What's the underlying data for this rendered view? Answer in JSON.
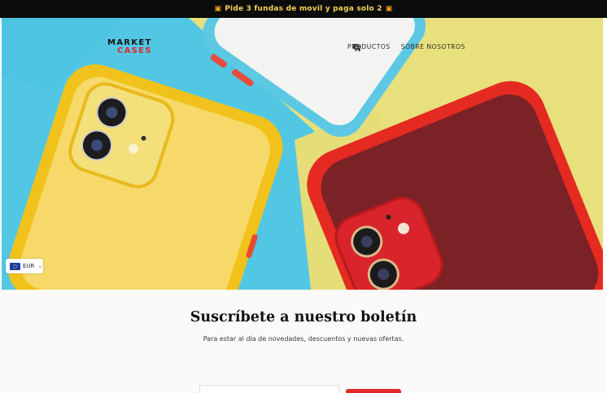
{
  "announcement": {
    "text": "Pide 3 fundas de movil y paga solo 2",
    "icon_left": "gift-icon",
    "icon_right": "gift-icon"
  },
  "header": {
    "logo_line1": "MARKET",
    "logo_line2": "CASES",
    "nav": {
      "products": "PRODUCTOS",
      "about": "SOBRE NOSOTROS"
    },
    "icons": {
      "search": "search-icon",
      "cart": "cart-icon"
    }
  },
  "currency": {
    "selected": "EUR",
    "flag_icon": "eu-flag-icon",
    "chevron": "chevron-down-icon"
  },
  "newsletter": {
    "title": "Suscríbete a nuestro boletín",
    "subtitle": "Para estar al día de novedades, descuentos y nuevas ofertas."
  },
  "colors": {
    "brand_red": "#e0262a",
    "announcement_bg": "#0b0b0b",
    "announcement_text": "#f4d25a",
    "button": "#e2292e"
  }
}
